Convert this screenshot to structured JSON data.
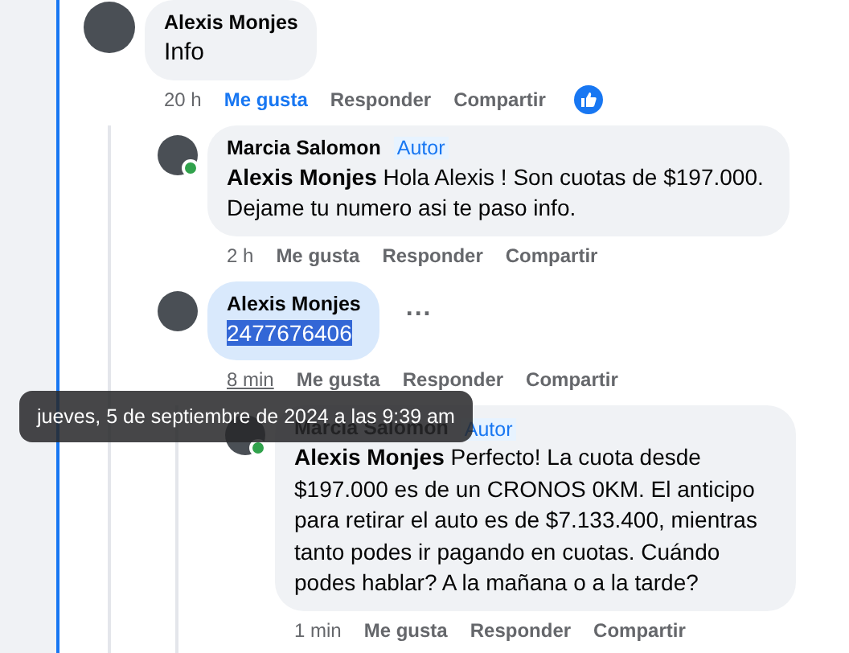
{
  "comments": [
    {
      "author": "Alexis Monjes",
      "online": false,
      "text": "Info",
      "highlighted": false,
      "text_selected": false,
      "time": "20 h",
      "time_hovered": false,
      "liked": true,
      "actions": [
        "Me gusta",
        "Responder",
        "Compartir"
      ],
      "children": [
        {
          "author": "Marcia Salomon",
          "badge": "Autor",
          "online": true,
          "text": "**Alexis Monjes** Hola Alexis ! Son cuotas de $197.000. Dejame tu numero asi te paso info.",
          "highlighted": false,
          "text_selected": false,
          "time": "2 h",
          "time_hovered": false,
          "liked": false,
          "actions": [
            "Me gusta",
            "Responder",
            "Compartir"
          ]
        },
        {
          "author": "Alexis Monjes",
          "online": false,
          "text": "2477676406",
          "highlighted": true,
          "text_selected": true,
          "more_label": "...",
          "time": "8 min",
          "time_hovered": true,
          "liked": false,
          "actions": [
            "Me gusta",
            "Responder",
            "Compartir"
          ],
          "children": [
            {
              "author": "Marcia Salomon",
              "badge": "Autor",
              "online": true,
              "text": "**Alexis Monjes** Perfecto! La cuota desde $197.000 es de un CRONOS 0KM. El anticipo para retirar el auto es de $7.133.400, mientras tanto podes ir pagando en cuotas. Cuándo podes hablar? A la mañana o a la tarde?",
              "highlighted": false,
              "text_selected": false,
              "time": "1 min",
              "time_hovered": false,
              "liked": false,
              "actions": [
                "Me gusta",
                "Responder",
                "Compartir"
              ]
            }
          ]
        }
      ]
    }
  ],
  "tooltip": {
    "text": "jueves, 5 de septiembre de 2024 a las 9:39 am"
  }
}
